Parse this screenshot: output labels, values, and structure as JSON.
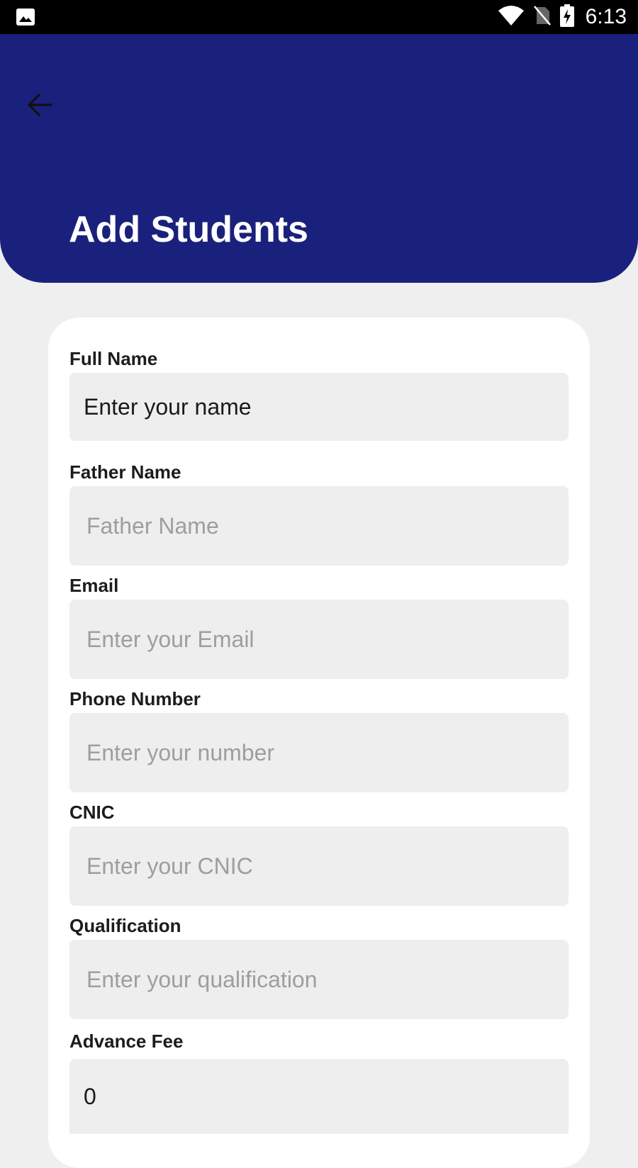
{
  "status_bar": {
    "time": "6:13",
    "icons": [
      "image-icon",
      "wifi-icon",
      "no-sim-icon",
      "battery-charging-icon"
    ]
  },
  "header": {
    "title": "Add Students",
    "back_icon": "arrow-left-icon",
    "color": "#1a217c"
  },
  "form": {
    "full_name": {
      "label": "Full Name",
      "value": "Enter your name",
      "placeholder": ""
    },
    "father_name": {
      "label": "Father Name",
      "value": "",
      "placeholder": "Father Name"
    },
    "email": {
      "label": "Email",
      "value": "",
      "placeholder": "Enter your Email"
    },
    "phone": {
      "label": "Phone Number",
      "value": "",
      "placeholder": "Enter your number"
    },
    "cnic": {
      "label": "CNIC",
      "value": "",
      "placeholder": "Enter your CNIC"
    },
    "qualification": {
      "label": "Qualification",
      "value": "",
      "placeholder": "Enter your qualification"
    },
    "advance_fee": {
      "label": "Advance Fee",
      "value": "0",
      "placeholder": ""
    }
  }
}
